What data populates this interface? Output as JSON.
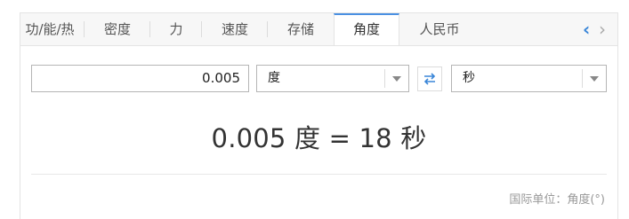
{
  "tabs": [
    {
      "label": "功/能/热",
      "active": false
    },
    {
      "label": "密度",
      "active": false
    },
    {
      "label": "力",
      "active": false
    },
    {
      "label": "速度",
      "active": false
    },
    {
      "label": "存储",
      "active": false
    },
    {
      "label": "角度",
      "active": true
    },
    {
      "label": "人民币",
      "active": false
    }
  ],
  "nav": {
    "prev_icon": "chevron-left-icon",
    "next_icon": "chevron-right-icon"
  },
  "converter": {
    "input_value": "0.005",
    "from_unit": "度",
    "to_unit": "秒",
    "swap_icon": "swap-arrows-icon",
    "result_text": "0.005 度 = 18 秒"
  },
  "footer": {
    "si_unit_text": "国际单位：角度(°)"
  },
  "colors": {
    "accent": "#4a90e2",
    "swap_icon": "#3a86d8"
  }
}
